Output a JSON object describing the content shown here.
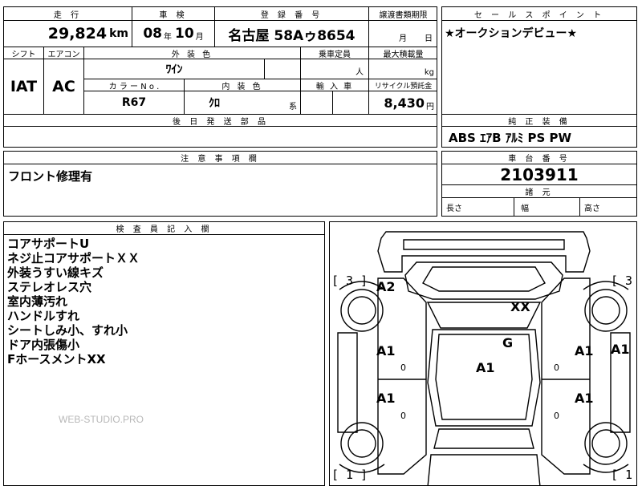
{
  "top": {
    "mileage_header": "走 行",
    "mileage_value": "29,824",
    "mileage_unit": "km",
    "inspection_header": "車 検",
    "inspection_year": "08",
    "inspection_year_unit": "年",
    "inspection_month": "10",
    "inspection_month_unit": "月",
    "registration_header": "登 録 番 号",
    "registration_value": "名古屋 58Aゥ8654",
    "transfer_header": "譲渡書類期限",
    "transfer_month": "月",
    "transfer_day": "日"
  },
  "specs": {
    "shift_header": "シフト",
    "shift_value": "IAT",
    "ac_header": "エアコン",
    "ac_value": "AC",
    "exterior_header": "外 装 色",
    "exterior_value": "ﾜｲﾝ",
    "capacity_header": "乗車定員",
    "capacity_unit": "人",
    "load_header": "最大積載量",
    "load_unit": "kg",
    "color_no_header": "カ ラ ー N o .",
    "color_no_value": "R67",
    "interior_header": "内 装 色",
    "interior_value": "ｸﾛ",
    "interior_suffix": "系",
    "import_header": "輸 入 車",
    "recycle_header": "リサイクル預託金",
    "recycle_value": "8,430",
    "recycle_unit": "円",
    "later_parts_header": "後 日 発 送 部 品"
  },
  "sales_point": {
    "header": "セ ー ル ス ポ イ ン ト",
    "text": "★オークションデビュー★"
  },
  "equipment": {
    "header": "純 正 装 備",
    "text": "ABS ｴｱB ｱﾙﾐ PS PW"
  },
  "notes": {
    "header": "注 意 事 項 欄",
    "text": "フロント修理有"
  },
  "chassis": {
    "header": "車 台 番 号",
    "value": "2103911",
    "dims_header": "諸 元",
    "length_label": "長さ",
    "width_label": "幅",
    "height_label": "高さ"
  },
  "inspector": {
    "header": "検 査 員 記 入 欄",
    "lines": [
      "コアサポートU",
      "ネジ止コアサポートＸＸ",
      "外装うすい線キズ",
      "ステレオレス穴",
      "室内薄汚れ",
      "ハンドルすれ",
      "シートしみ小、すれ小",
      "ドア内張傷小",
      "FホースメントXX"
    ],
    "watermark": "WEB-STUDIO.PRO"
  },
  "diagram": {
    "bracket_top_left": "[ 3 ]",
    "bracket_top_right": "[ 3",
    "bracket_bottom_left": "[ 1 ]",
    "bracket_bottom_right": "[ 1",
    "marks": [
      "A2",
      "XX",
      "G",
      "A1",
      "A1",
      "A1",
      "A1",
      "A1",
      "A1"
    ],
    "zeros": [
      "0",
      "0",
      "0",
      "0"
    ]
  }
}
